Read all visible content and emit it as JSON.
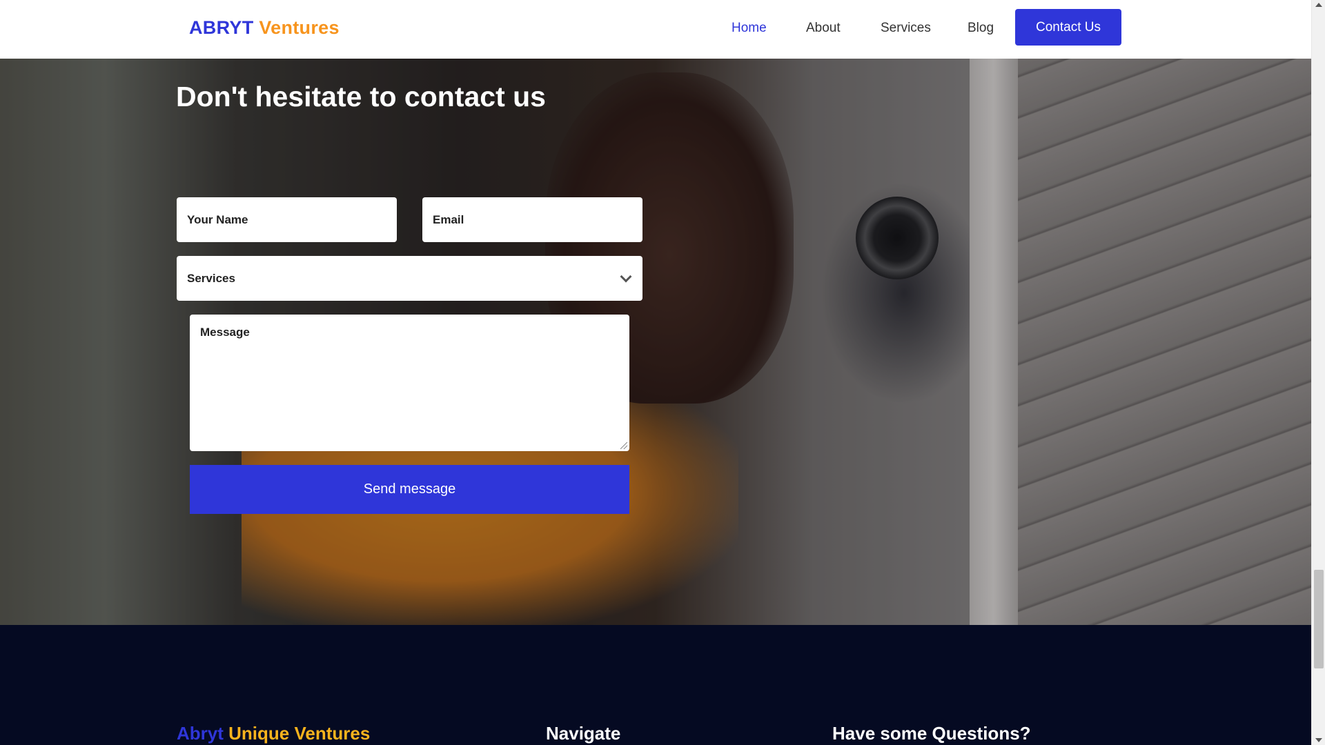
{
  "header": {
    "logo_part1": "ABRYT",
    "logo_part2": "Ventures",
    "nav": [
      {
        "label": "Home",
        "active": true
      },
      {
        "label": "About",
        "active": false
      },
      {
        "label": "Services",
        "active": false
      },
      {
        "label": "Blog",
        "active": false
      }
    ],
    "contact_button": "Contact Us"
  },
  "hero": {
    "title": "Don't hesitate to contact us",
    "form": {
      "name_placeholder": "Your Name",
      "email_placeholder": "Email",
      "services_selected": "Services",
      "message_placeholder": "Message",
      "submit_label": "Send message"
    }
  },
  "footer": {
    "brand_part1": "Abryt",
    "brand_part2": "Unique Ventures",
    "navigate_heading": "Navigate",
    "questions_heading": "Have some Questions?"
  },
  "colors": {
    "accent": "#2f36d9",
    "brand_orange": "#f7941d",
    "footer_bg": "#050a22"
  }
}
